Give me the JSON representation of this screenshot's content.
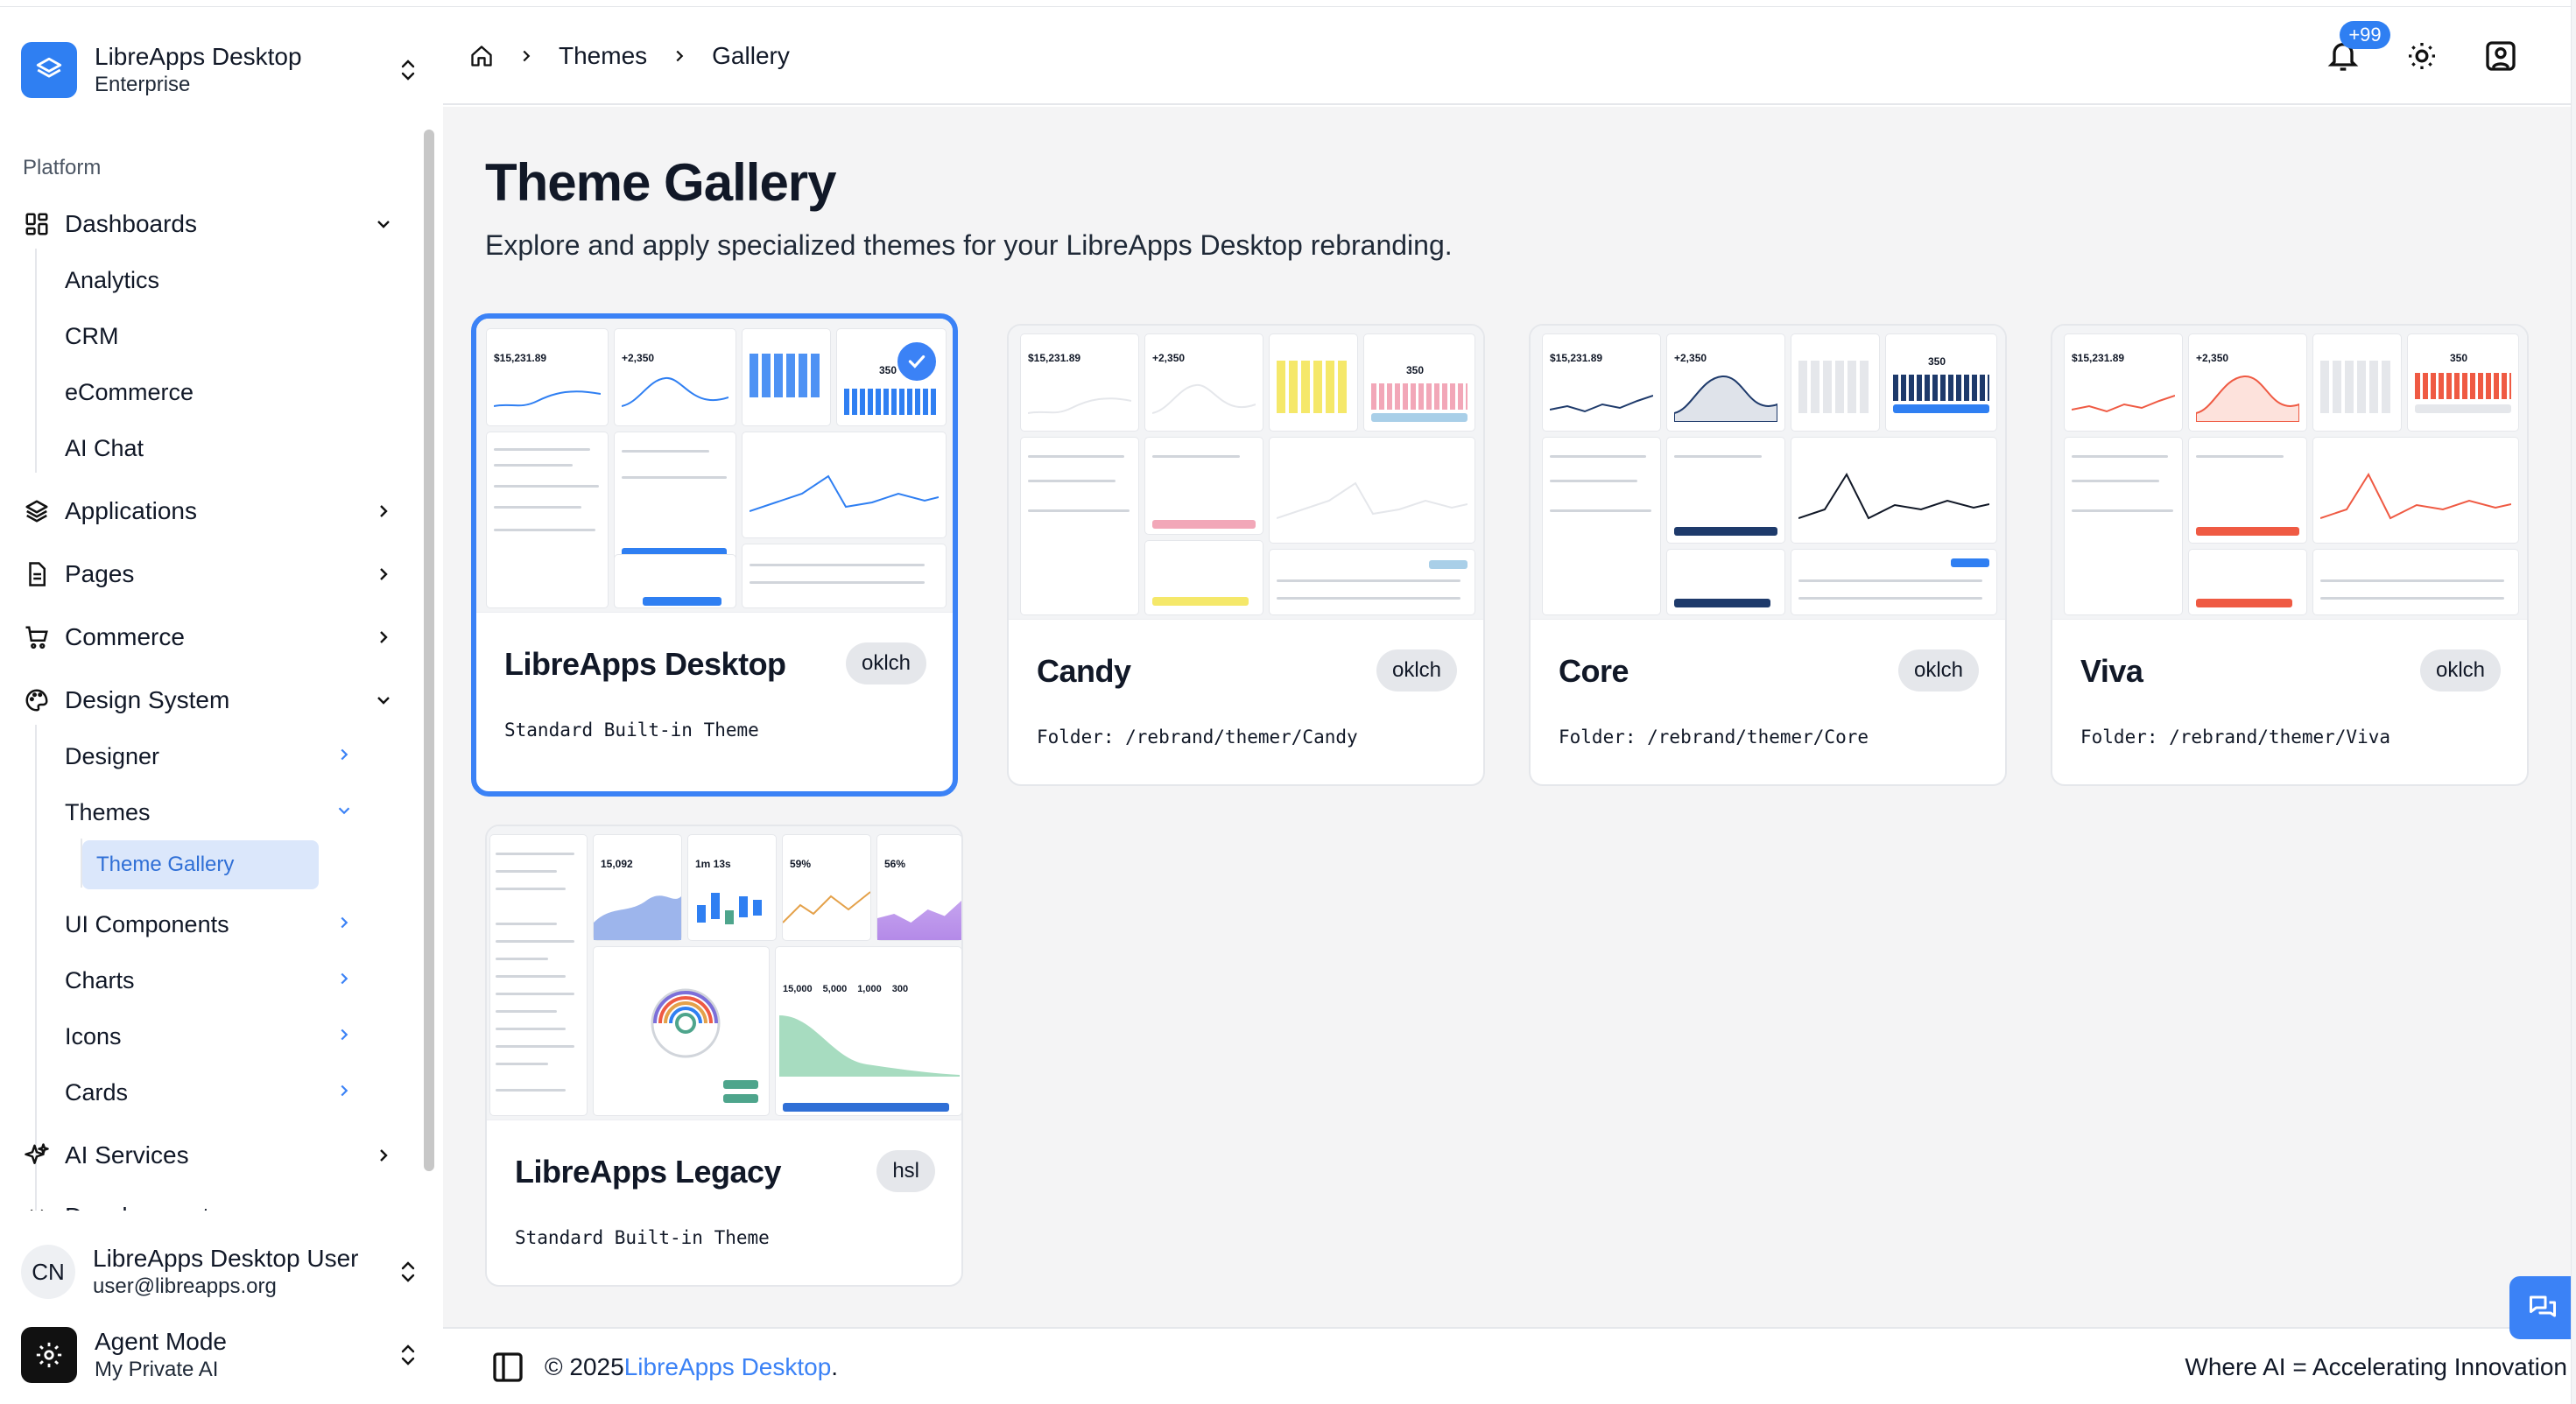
{
  "app": {
    "name": "LibreApps Desktop",
    "edition": "Enterprise"
  },
  "sidebar": {
    "section_label": "Platform",
    "items": [
      {
        "label": "Dashboards",
        "icon": "dashboard-icon",
        "expanded": true,
        "children": [
          "Analytics",
          "CRM",
          "eCommerce",
          "AI Chat"
        ]
      },
      {
        "label": "Applications",
        "icon": "layers-icon"
      },
      {
        "label": "Pages",
        "icon": "document-icon"
      },
      {
        "label": "Commerce",
        "icon": "cart-icon"
      },
      {
        "label": "Design System",
        "icon": "palette-icon",
        "expanded": true,
        "children": [
          "Designer",
          "Themes",
          "UI Components",
          "Charts",
          "Icons",
          "Cards"
        ],
        "themes_children": [
          "Theme Gallery"
        ]
      },
      {
        "label": "AI Services",
        "icon": "sparkles-icon"
      },
      {
        "label": "Development",
        "icon": "code-icon"
      }
    ],
    "active_item": "Theme Gallery"
  },
  "user": {
    "initials": "CN",
    "name": "LibreApps Desktop User",
    "email": "user@libreapps.org"
  },
  "agent": {
    "title": "Agent Mode",
    "subtitle": "My Private AI"
  },
  "breadcrumb": [
    "Themes",
    "Gallery"
  ],
  "notifications": {
    "count": "+99"
  },
  "page": {
    "title": "Theme Gallery",
    "description": "Explore and apply specialized themes for your LibreApps Desktop rebranding."
  },
  "themes": [
    {
      "name": "LibreApps Desktop",
      "badge": "oklch",
      "folder": "Standard Built-in Theme",
      "selected": true,
      "accent": "#2f7ff2"
    },
    {
      "name": "Candy",
      "badge": "oklch",
      "folder": "Folder: /rebrand/themer/Candy",
      "selected": false,
      "accent": "#f2a7b8"
    },
    {
      "name": "Core",
      "badge": "oklch",
      "folder": "Folder: /rebrand/themer/Core",
      "selected": false,
      "accent": "#1e3a6b"
    },
    {
      "name": "Viva",
      "badge": "oklch",
      "folder": "Folder: /rebrand/themer/Viva",
      "selected": false,
      "accent": "#ef5a43"
    },
    {
      "name": "LibreApps Legacy",
      "badge": "hsl",
      "folder": "Standard Built-in Theme",
      "selected": false,
      "accent": "#7c6fd9"
    }
  ],
  "thumb_text": {
    "amount": "$15,231.89",
    "subs": "+2,350",
    "goal": "350"
  },
  "legacy_thumb": {
    "stat1": "15,092",
    "stat2": "1m 13s",
    "stat3": "59%",
    "stat4": "56%",
    "f1": "15,000",
    "f2": "5,000",
    "f3": "1,000",
    "f4": "300"
  },
  "footer": {
    "copyright": "© 2025 ",
    "link": "LibreApps Desktop",
    "period": ".",
    "tagline": "Where AI = Accelerating Innovation"
  }
}
